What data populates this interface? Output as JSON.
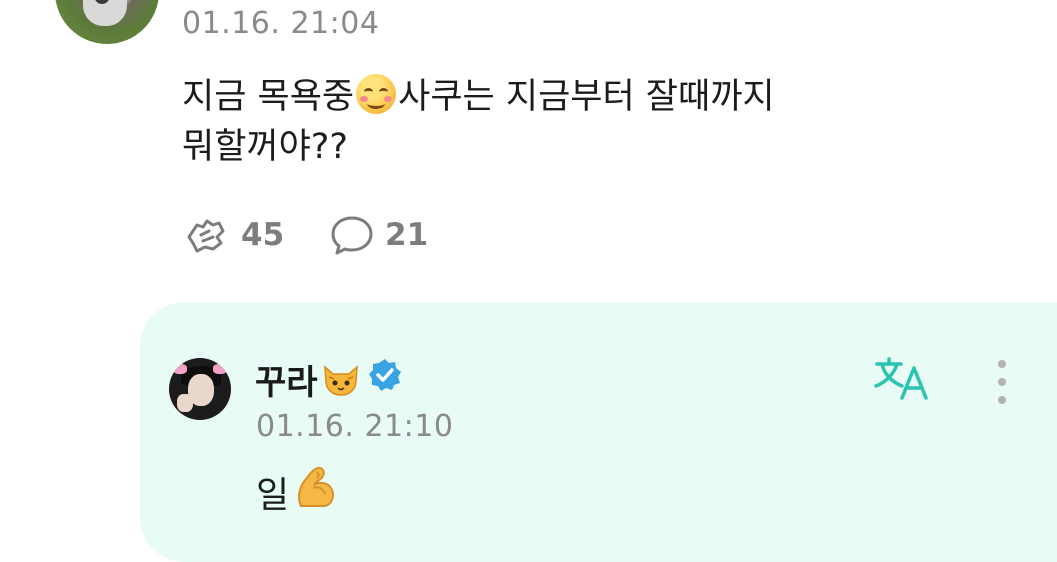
{
  "post": {
    "timestamp": "01.16. 21:04",
    "text_line1_before": "지금 목욕중",
    "text_line1_emoji": "relieved-face",
    "text_line1_after": "사쿠는 지금부터 잘때까지",
    "text_line2": "뭐할꺼야??",
    "likes_count": "45",
    "comments_count": "21"
  },
  "reply": {
    "username": "꾸라",
    "username_emoji": "cat-face",
    "verified": true,
    "timestamp": "01.16. 21:10",
    "text": "일",
    "text_emoji": "flexed-biceps"
  },
  "colors": {
    "reply_background": "#e8fbf5",
    "accent_teal": "#2bc4b0",
    "verified_blue": "#3aa3e3",
    "muted_text": "#8a8a8a"
  },
  "icons": {
    "like": "like-hands-icon",
    "comment": "comment-bubble-icon",
    "translate": "translate-icon",
    "more": "more-vertical-icon"
  }
}
